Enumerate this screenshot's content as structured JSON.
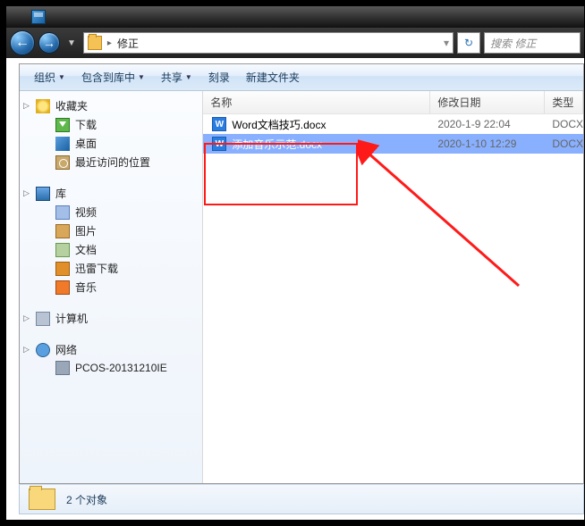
{
  "breadcrumb": {
    "folder": "修正"
  },
  "search": {
    "placeholder": "搜索 修正"
  },
  "toolbar": {
    "organize": "组织",
    "include": "包含到库中",
    "share": "共享",
    "burn": "刻录",
    "newfolder": "新建文件夹"
  },
  "sidebar": {
    "favorites": {
      "label": "收藏夹"
    },
    "downloads": {
      "label": "下载"
    },
    "desktop": {
      "label": "桌面"
    },
    "recent": {
      "label": "最近访问的位置"
    },
    "libraries": {
      "label": "库"
    },
    "videos": {
      "label": "视频"
    },
    "pictures": {
      "label": "图片"
    },
    "documents": {
      "label": "文档"
    },
    "thunder": {
      "label": "迅雷下载"
    },
    "music": {
      "label": "音乐"
    },
    "computer": {
      "label": "计算机"
    },
    "network": {
      "label": "网络"
    },
    "pc_node": {
      "label": "PCOS-20131210IE"
    }
  },
  "columns": {
    "name": "名称",
    "date": "修改日期",
    "type": "类型"
  },
  "files": {
    "r0": {
      "name": "Word文档技巧.docx",
      "date": "2020-1-9 22:04",
      "type": "DOCX"
    },
    "r1": {
      "name": "添加音乐示范.docx",
      "date": "2020-1-10 12:29",
      "type": "DOCX"
    }
  },
  "status": {
    "count": "2 个对象"
  }
}
